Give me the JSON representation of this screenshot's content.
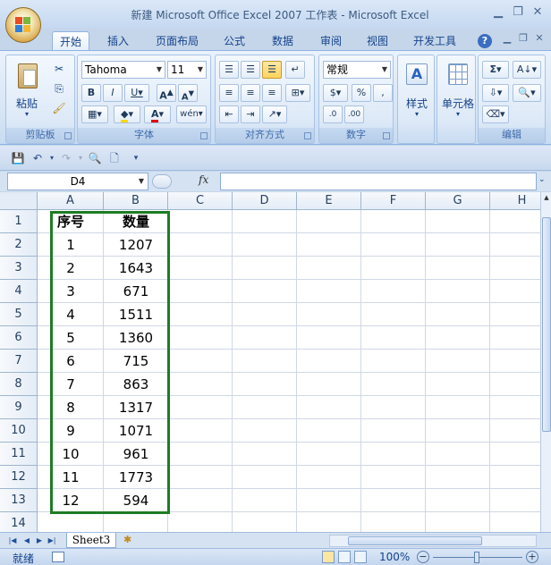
{
  "window": {
    "title": "新建 Microsoft Office Excel 2007 工作表 - Microsoft Excel"
  },
  "tabs": [
    "开始",
    "插入",
    "页面布局",
    "公式",
    "数据",
    "审阅",
    "视图",
    "开发工具"
  ],
  "ribbon": {
    "clipboard": {
      "paste_label": "粘贴",
      "group_label": "剪贴板"
    },
    "font": {
      "font_name": "Tahoma",
      "font_size": "11",
      "group_label": "字体"
    },
    "alignment": {
      "group_label": "对齐方式"
    },
    "number": {
      "format": "常规",
      "group_label": "数字"
    },
    "styles": {
      "label": "样式"
    },
    "cells": {
      "label": "单元格"
    },
    "editing": {
      "group_label": "编辑"
    }
  },
  "formula_bar": {
    "name_box": "D4",
    "fx_label": "fx",
    "formula": ""
  },
  "columns": [
    "A",
    "B",
    "C",
    "D",
    "E",
    "F",
    "G",
    "H"
  ],
  "rows": [
    "1",
    "2",
    "3",
    "4",
    "5",
    "6",
    "7",
    "8",
    "9",
    "10",
    "11",
    "12",
    "13",
    "14"
  ],
  "table": {
    "headers": [
      "序号",
      "数量"
    ],
    "data": [
      [
        "1",
        "1207"
      ],
      [
        "2",
        "1643"
      ],
      [
        "3",
        "671"
      ],
      [
        "4",
        "1511"
      ],
      [
        "5",
        "1360"
      ],
      [
        "6",
        "715"
      ],
      [
        "7",
        "863"
      ],
      [
        "8",
        "1317"
      ],
      [
        "9",
        "1071"
      ],
      [
        "10",
        "961"
      ],
      [
        "11",
        "1773"
      ],
      [
        "12",
        "594"
      ]
    ]
  },
  "sheet_tab": "Sheet3",
  "status": {
    "ready": "就绪",
    "zoom": "100%"
  },
  "colors": {
    "selection_border": "#1e7c24",
    "ribbon_bg": "#d5e4f5",
    "header_bg": "#e4ecf7"
  }
}
